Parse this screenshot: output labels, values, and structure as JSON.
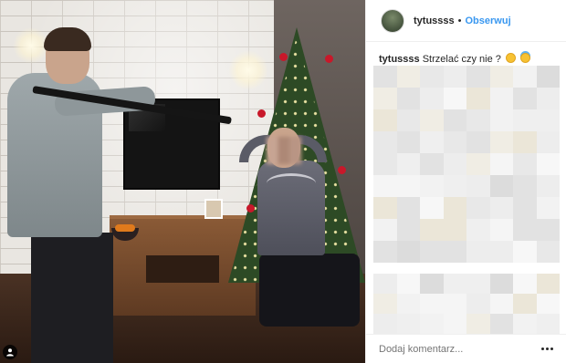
{
  "post": {
    "username": "tytussss",
    "separator": "•",
    "follow_label": "Obserwuj",
    "caption": {
      "user": "tytussss",
      "text": "Strzelać czy nie ?",
      "emojis": [
        "laughing-tears-emoji",
        "innocent-halo-emoji"
      ]
    },
    "comment_placeholder": "Dodaj komentarz...",
    "more_options_icon": "ellipsis-icon",
    "user_tag_icon": "user-tag-icon"
  },
  "colors": {
    "accent_link": "#3897f0",
    "text_primary": "#262626",
    "text_placeholder": "#999999",
    "divider": "#efefef"
  },
  "redacted_comments": {
    "description_visible": false
  }
}
